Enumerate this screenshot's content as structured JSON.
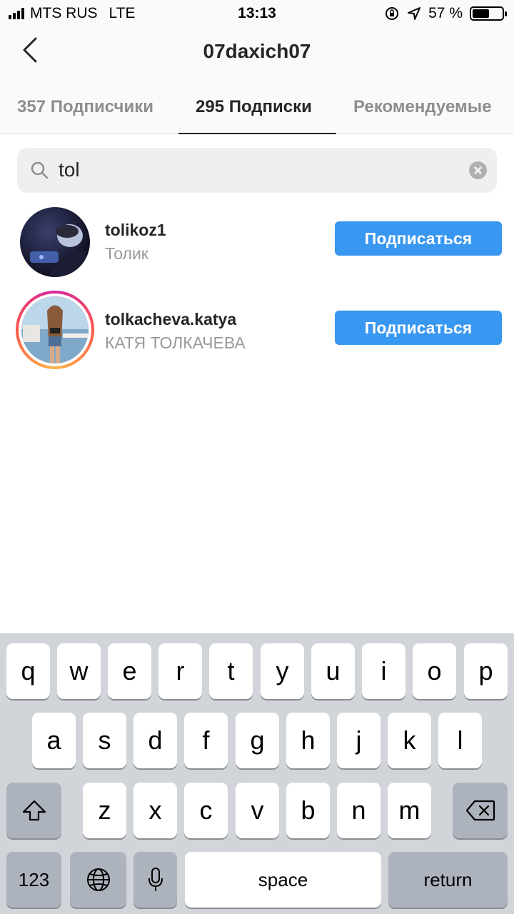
{
  "status_bar": {
    "carrier": "MTS RUS",
    "network": "LTE",
    "time": "13:13",
    "battery_text": "57 %",
    "battery_level": 0.57
  },
  "header": {
    "title": "07daxich07",
    "back_icon": "chevron-left-icon"
  },
  "tabs": [
    {
      "label": "357 Подписчики",
      "active": false
    },
    {
      "label": "295 Подписки",
      "active": true
    },
    {
      "label": "Рекомендуемые",
      "active": false
    }
  ],
  "search": {
    "value": "tol",
    "icon": "search-icon",
    "clear_icon": "clear-icon"
  },
  "results": [
    {
      "username": "tolikoz1",
      "full_name": "Толик",
      "button_label": "Подписаться",
      "has_story_ring": false
    },
    {
      "username": "tolkacheva.katya",
      "full_name": "КАТЯ ТОЛКАЧЕВА",
      "button_label": "Подписаться",
      "has_story_ring": true
    }
  ],
  "colors": {
    "accent": "#3897f0",
    "story_ring": [
      "#d6249f",
      "#fd5949",
      "#fdb34a"
    ]
  },
  "keyboard": {
    "row1": [
      "q",
      "w",
      "e",
      "r",
      "t",
      "y",
      "u",
      "i",
      "o",
      "p"
    ],
    "row2": [
      "a",
      "s",
      "d",
      "f",
      "g",
      "h",
      "j",
      "k",
      "l"
    ],
    "row3": [
      "z",
      "x",
      "c",
      "v",
      "b",
      "n",
      "m"
    ],
    "numbers_label": "123",
    "space_label": "space",
    "return_label": "return",
    "shift_icon": "shift-icon",
    "backspace_icon": "backspace-icon",
    "globe_icon": "globe-icon",
    "mic_icon": "microphone-icon"
  }
}
